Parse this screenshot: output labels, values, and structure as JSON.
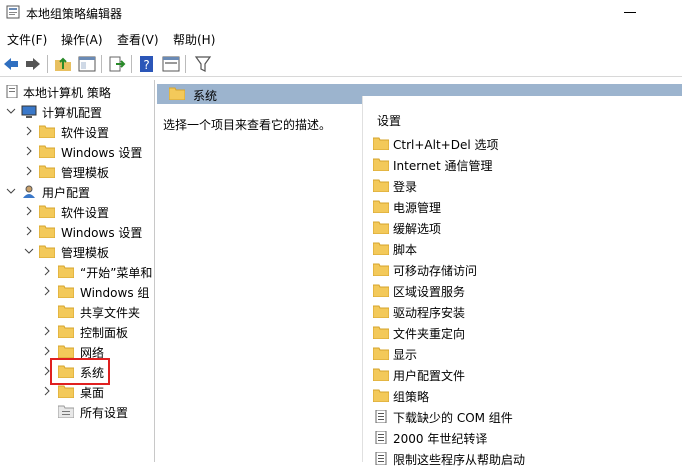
{
  "window": {
    "title": "本地组策略编辑器"
  },
  "menu": [
    "文件(F)",
    "操作(A)",
    "查看(V)",
    "帮助(H)"
  ],
  "tree": {
    "root": "本地计算机 策略",
    "computer_config": "计算机配置",
    "user_config": "用户配置",
    "items": {
      "cc_software": "软件设置",
      "cc_windows": "Windows 设置",
      "cc_admin": "管理模板",
      "uc_software": "软件设置",
      "uc_windows": "Windows 设置",
      "uc_admin": "管理模板",
      "start": "“开始”菜单和",
      "win_components": "Windows 组",
      "shared": "共享文件夹",
      "control": "控制面板",
      "network": "网络",
      "system": "系统",
      "desktop": "桌面",
      "all": "所有设置"
    }
  },
  "right": {
    "header": "系统",
    "description": "选择一个项目来查看它的描述。",
    "column": "设置",
    "items": [
      "Ctrl+Alt+Del 选项",
      "Internet 通信管理",
      "登录",
      "电源管理",
      "缓解选项",
      "脚本",
      "可移动存储访问",
      "区域设置服务",
      "驱动程序安装",
      "文件夹重定向",
      "显示",
      "用户配置文件",
      "组策略",
      "下载缺少的 COM 组件",
      "2000 年世纪转译",
      "限制这些程序从帮助启动"
    ]
  }
}
